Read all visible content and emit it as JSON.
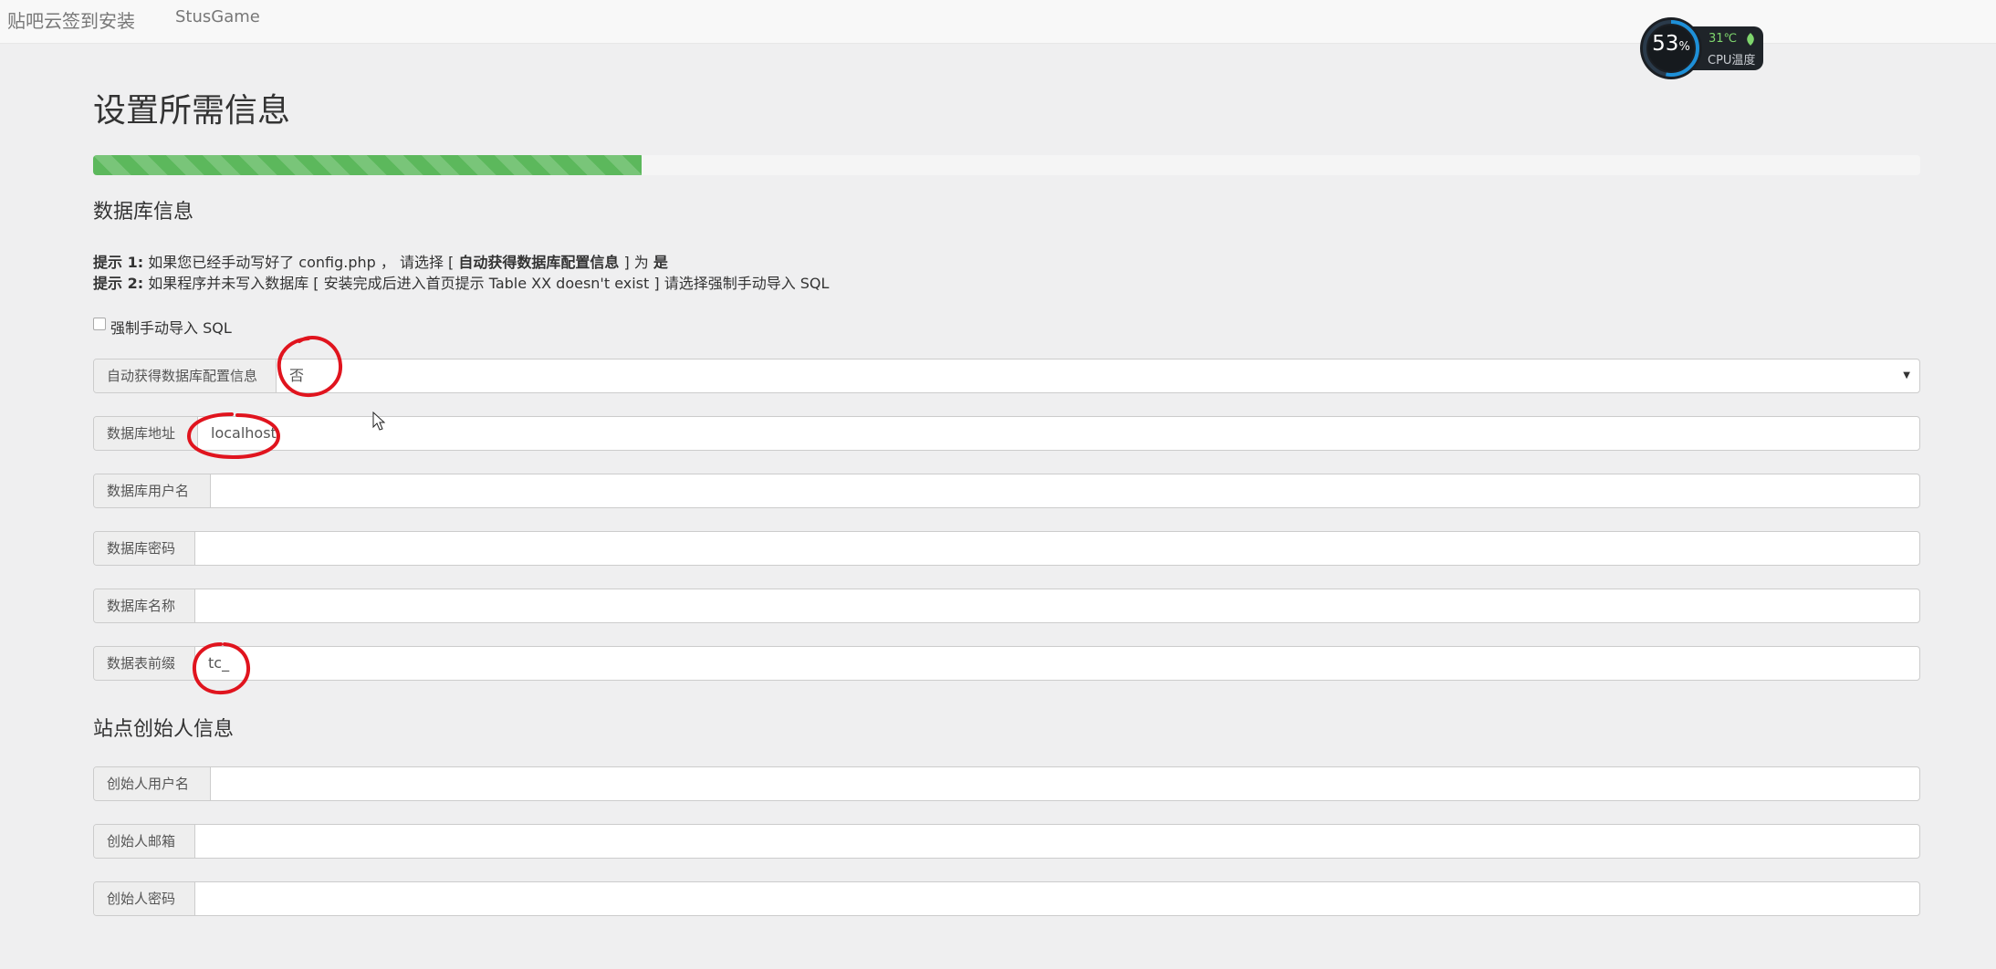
{
  "navbar": {
    "brand": "贴吧云签到安装",
    "link": "StusGame"
  },
  "cpu_widget": {
    "percent_value": "53",
    "percent_unit": "%",
    "temperature": "31℃",
    "label": "CPU温度",
    "accent_color": "#1e90d8",
    "temp_color": "#7fd66d",
    "icon": "leaf-icon"
  },
  "page": {
    "title": "设置所需信息",
    "progress_fraction": 0.3,
    "progress_color": "#5cb85c"
  },
  "db_section": {
    "title": "数据库信息",
    "tip1_label": "提示 1:",
    "tip1_a": " 如果您已经手动写好了 config.php ， 请选择 [ ",
    "tip1_b": "自动获得数据库配置信息",
    "tip1_c": " ] 为 ",
    "tip1_d": "是",
    "tip2_label": "提示 2:",
    "tip2_text": " 如果程序并未写入数据库 [ 安装完成后进入首页提示 Table XX doesn't exist ] 请选择强制手动导入 SQL",
    "force_sql_label": "强制手动导入 SQL",
    "fields": [
      {
        "label": "自动获得数据库配置信息",
        "value": "否"
      },
      {
        "label": "数据库地址",
        "value": "localhost"
      },
      {
        "label": "数据库用户名",
        "value": ""
      },
      {
        "label": "数据库密码",
        "value": ""
      },
      {
        "label": "数据库名称",
        "value": ""
      },
      {
        "label": "数据表前缀",
        "value": "tc_"
      }
    ]
  },
  "founder_section": {
    "title": "站点创始人信息",
    "fields": [
      {
        "label": "创始人用户名",
        "value": ""
      },
      {
        "label": "创始人邮箱",
        "value": ""
      },
      {
        "label": "创始人密码",
        "value": ""
      }
    ]
  },
  "annotation_color": "#e0141e"
}
